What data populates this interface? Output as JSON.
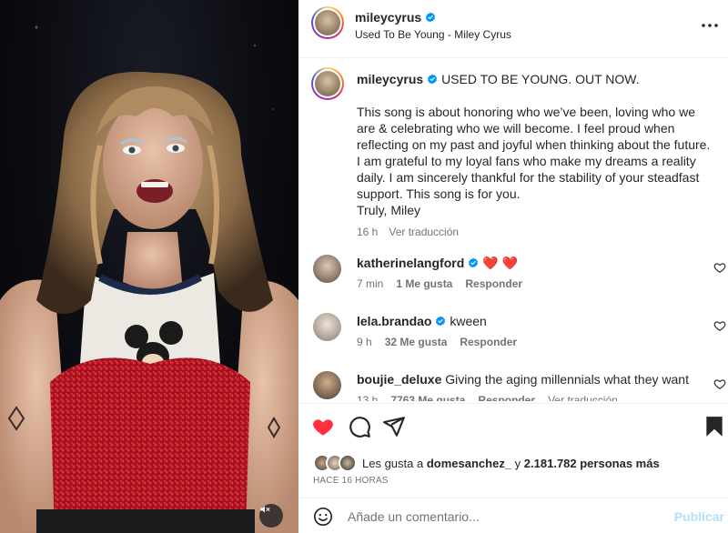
{
  "post": {
    "username": "mileycyrus",
    "audio": "Used To Be Young - Miley Cyrus",
    "caption_headline": "USED TO BE YOUNG. OUT NOW.",
    "caption_body": "This song is about honoring who we’ve been, loving who we are & celebrating who we will become. I feel proud when reflecting on my past and joyful when thinking about the future. I am grateful to my loyal fans who make my dreams a reality daily. I am sincerely thankful for the stability of your steadfast support. This song is for you.",
    "caption_sign": "Truly, Miley",
    "caption_time": "16 h",
    "translate": "Ver traducción"
  },
  "comments": [
    {
      "username": "katherinelangford",
      "text": "❤️ ❤️",
      "verified": true,
      "time": "7 min",
      "likes": "1 Me gusta",
      "reply": "Responder"
    },
    {
      "username": "lela.brandao",
      "text": "kween",
      "verified": true,
      "time": "9 h",
      "likes": "32 Me gusta",
      "reply": "Responder"
    },
    {
      "username": "boujie_deluxe",
      "text": "Giving the aging millennials what they want",
      "verified": false,
      "time": "13 h",
      "likes": "7763 Me gusta",
      "reply": "Responder",
      "translate": "Ver traducción"
    }
  ],
  "likes_bar": {
    "prefix": "Les gusta a",
    "user": "domesanchez_",
    "and": "y",
    "count": "2.181.782 personas más",
    "ago": "HACE 16 HORAS"
  },
  "comment_input": {
    "placeholder": "Añade un comentario...",
    "publish": "Publicar"
  },
  "colors": {
    "like_red": "#ff3040",
    "verified_blue": "#0095f6",
    "publish_disabled": "#b2dffc"
  },
  "icons": [
    "sound-off-icon",
    "more-icon",
    "verified-icon",
    "heart-icon",
    "comment-icon",
    "share-icon",
    "save-icon",
    "emoji-icon"
  ]
}
